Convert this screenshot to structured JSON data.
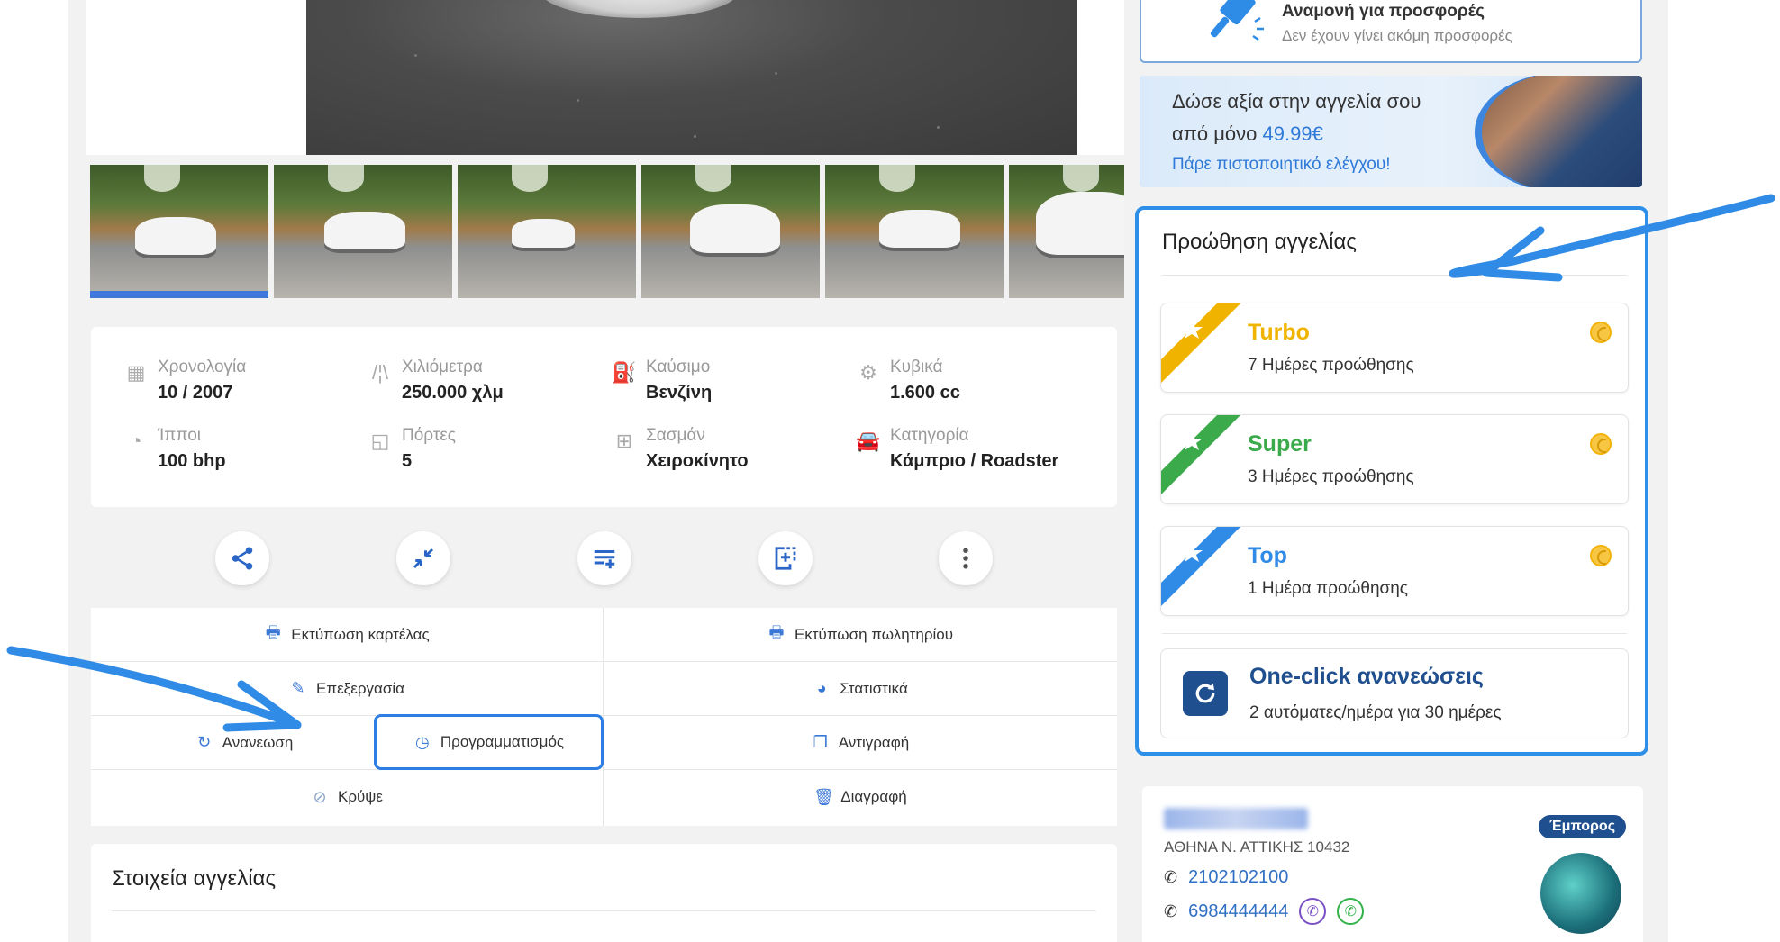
{
  "offers": {
    "title": "Αναμονή για προσφορές",
    "subtitle": "Δεν έχουν γίνει ακόμη προσφορές"
  },
  "value_banner": {
    "line1": "Δώσε αξία στην αγγελία σου",
    "line2_prefix": "από μόνο ",
    "price": "49.99€",
    "cta": "Πάρε πιστοποιητικό ελέγχου!"
  },
  "specs": [
    {
      "icon": "calendar-icon",
      "label": "Χρονολογία",
      "value": "10 / 2007"
    },
    {
      "icon": "road-icon",
      "label": "Χιλιόμετρα",
      "value": "250.000 χλμ"
    },
    {
      "icon": "fuel-icon",
      "label": "Καύσιμο",
      "value": "Βενζίνη"
    },
    {
      "icon": "engine-icon",
      "label": "Κυβικά",
      "value": "1.600 cc"
    },
    {
      "icon": "speedometer-icon",
      "label": "Ίπποι",
      "value": "100 bhp"
    },
    {
      "icon": "door-icon",
      "label": "Πόρτες",
      "value": "5"
    },
    {
      "icon": "gearbox-icon",
      "label": "Σασμάν",
      "value": "Χειροκίνητο"
    },
    {
      "icon": "car-icon",
      "label": "Κατηγορία",
      "value": "Κάμπριο / Roadster"
    }
  ],
  "action_icons": [
    "share-icon",
    "compare-icon",
    "list-add-icon",
    "copy-add-icon",
    "more-icon"
  ],
  "actions": {
    "print_card": "Εκτύπωση καρτέλας",
    "print_sale": "Εκτύπωση πωλητηρίου",
    "edit": "Επεξεργασία",
    "stats": "Στατιστικά",
    "renew": "Ανανεωση",
    "schedule": "Προγραμματισμός",
    "copy": "Αντιγραφή",
    "hide": "Κρύψε",
    "delete": "Διαγραφή"
  },
  "details": {
    "title": "Στοιχεία αγγελίας"
  },
  "promotion": {
    "title": "Προώθηση αγγελίας",
    "packages": [
      {
        "name": "Turbo",
        "desc": "7 Ημέρες προώθησης",
        "color": "#f0b400"
      },
      {
        "name": "Super",
        "desc": "3 Ημέρες προώθησης",
        "color": "#3aaa4a"
      },
      {
        "name": "Top",
        "desc": "1 Ημέρα προώθησης",
        "color": "#2f8be6"
      }
    ],
    "oneclick": {
      "title": "One-click ανανεώσεις",
      "subtitle": "2 αυτόματες/ημέρα για 30 ημέρες"
    }
  },
  "seller": {
    "address": "ΑΘΗΝΑ Ν. ΑΤΤΙΚΗΣ 10432",
    "badge": "Έμπορος",
    "phones": [
      "2102102100",
      "6984444444"
    ]
  },
  "colors": {
    "accent": "#2d8fe8",
    "link": "#2f7ad8",
    "dark_blue": "#1f4f8e"
  }
}
